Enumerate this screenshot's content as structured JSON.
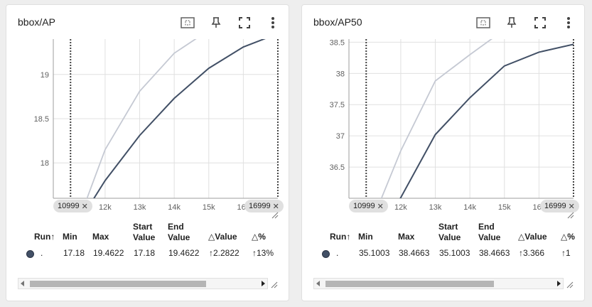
{
  "cards": [
    {
      "title": "bbox/AP",
      "min_chip": "10999",
      "max_chip": "16999",
      "table": {
        "headers": {
          "run": "Run",
          "min": "Min",
          "max": "Max",
          "start": "Start Value",
          "end": "End Value",
          "dvalue": "Value",
          "dpct": "%"
        },
        "row": {
          "run": ".",
          "min": "17.18",
          "max": "19.4622",
          "start": "17.18",
          "end": "19.4622",
          "dvalue": "2.2822",
          "dpct": "13%"
        }
      }
    },
    {
      "title": "bbox/AP50",
      "min_chip": "10999",
      "max_chip": "16999",
      "table": {
        "headers": {
          "run": "Run",
          "min": "Min",
          "max": "Max",
          "start": "Start Value",
          "end": "End Value",
          "dvalue": "Value",
          "dpct": "%"
        },
        "row": {
          "run": ".",
          "min": "35.1003",
          "max": "38.4663",
          "start": "35.1003",
          "end": "38.4663",
          "dvalue": "3.366",
          "dpct": "1"
        }
      }
    }
  ],
  "chart_data": [
    {
      "type": "line",
      "title": "bbox/AP",
      "xlabel": "",
      "ylabel": "",
      "x_ticks": [
        "12k",
        "13k",
        "14k",
        "15k",
        "16k"
      ],
      "y_ticks": [
        "18",
        "18.5",
        "19"
      ],
      "xlim": [
        10500,
        17000
      ],
      "ylim": [
        17.6,
        19.4
      ],
      "grid": true,
      "markers_x": [
        10999,
        16999
      ],
      "series": [
        {
          "color": "#425066",
          "x": [
            10999,
            11999,
            12999,
            13999,
            14999,
            15999,
            16999
          ],
          "y": [
            17.18,
            17.8,
            18.31,
            18.73,
            19.07,
            19.31,
            19.4622
          ]
        },
        {
          "color": "#c5c9d3",
          "x": [
            10999,
            11999,
            12999,
            13999,
            14999
          ],
          "y": [
            17.1,
            18.15,
            18.81,
            19.24,
            19.5
          ]
        }
      ]
    },
    {
      "type": "line",
      "title": "bbox/AP50",
      "xlabel": "",
      "ylabel": "",
      "x_ticks": [
        "12k",
        "13k",
        "14k",
        "15k",
        "16k"
      ],
      "y_ticks": [
        "36.5",
        "37",
        "37.5",
        "38",
        "38.5"
      ],
      "xlim": [
        10500,
        17000
      ],
      "ylim": [
        36.0,
        38.55
      ],
      "grid": true,
      "markers_x": [
        10999,
        16999
      ],
      "series": [
        {
          "color": "#425066",
          "x": [
            10999,
            11999,
            12999,
            13999,
            14999,
            15999,
            16999
          ],
          "y": [
            35.1,
            36.01,
            37.02,
            37.61,
            38.12,
            38.34,
            38.4663
          ]
        },
        {
          "color": "#c5c9d3",
          "x": [
            10999,
            11999,
            12999,
            13999,
            14999
          ],
          "y": [
            35.4,
            36.76,
            37.88,
            38.3,
            38.7
          ]
        }
      ]
    }
  ]
}
